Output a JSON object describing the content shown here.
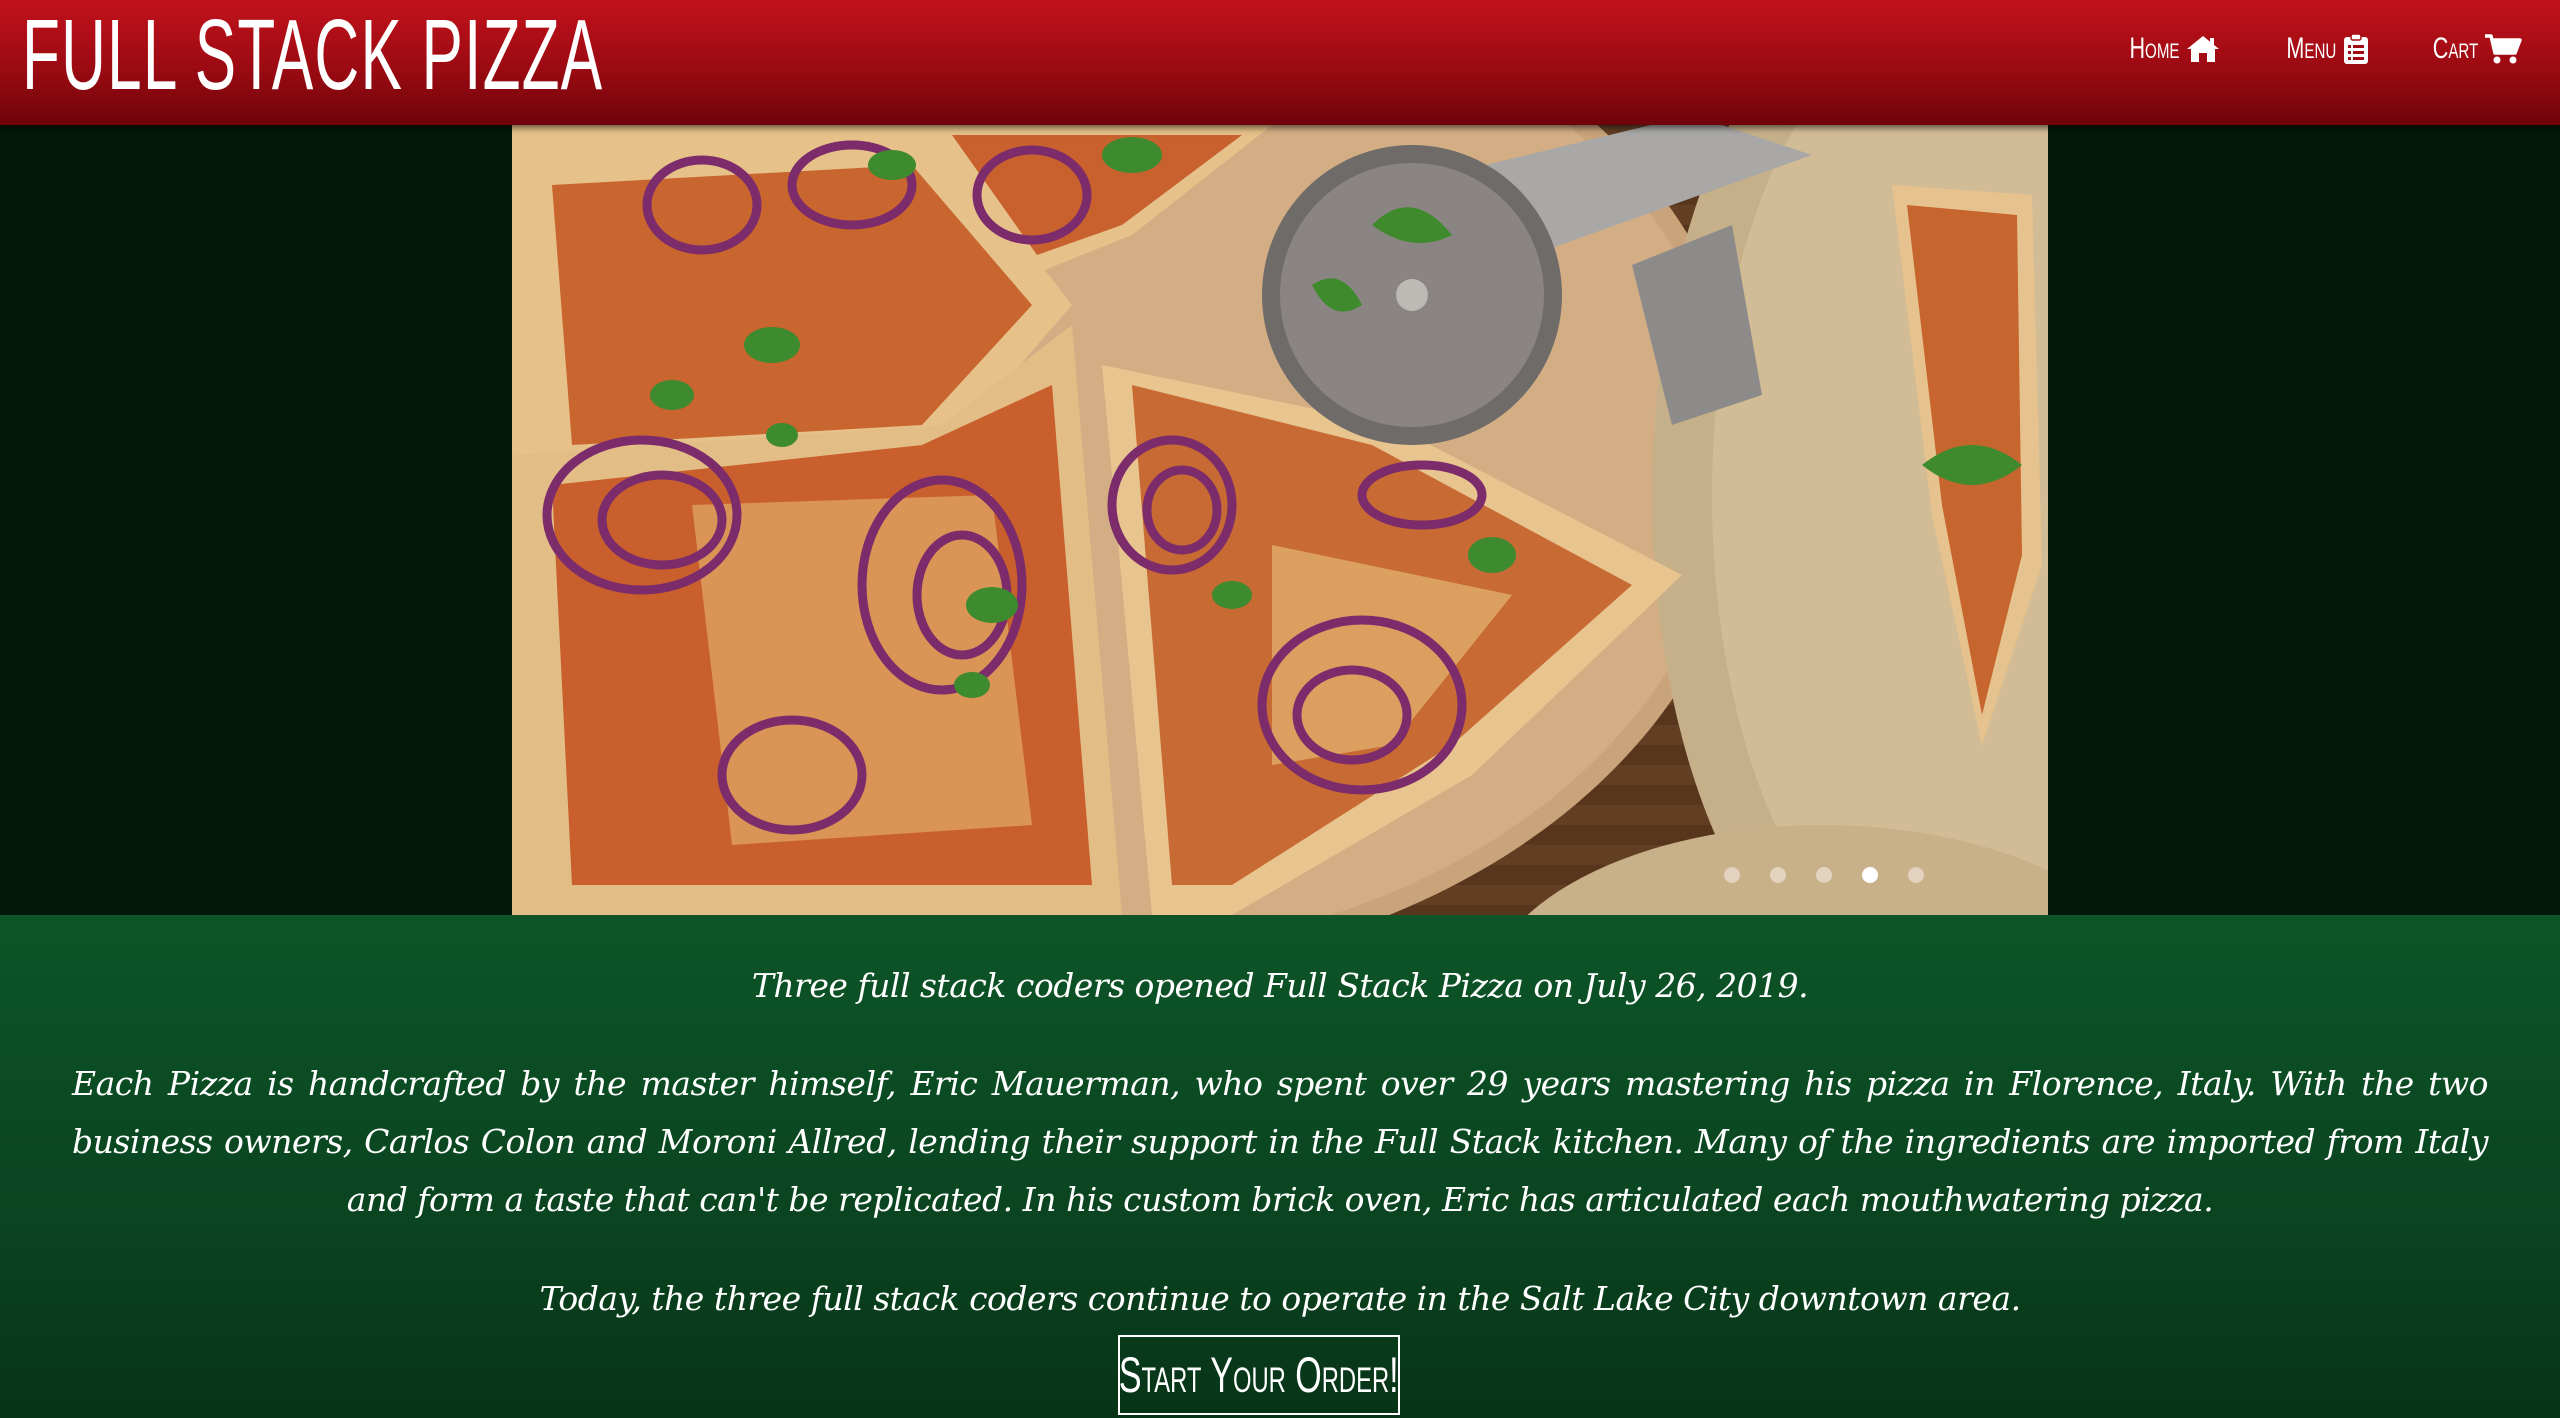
{
  "brand": {
    "title": "FULL STACK PIZZA"
  },
  "nav": {
    "items": [
      {
        "label": "Home",
        "icon": "home-icon"
      },
      {
        "label": "Menu",
        "icon": "clipboard-icon"
      },
      {
        "label": "Cart",
        "icon": "cart-icon"
      }
    ]
  },
  "carousel": {
    "slide_count": 5,
    "active_index": 3,
    "slide_subject": "pizza-photo"
  },
  "about": {
    "paragraph_1": "Three full stack coders opened Full Stack Pizza on July 26, 2019.",
    "paragraph_2": "Each Pizza is handcrafted by the master himself, Eric Mauerman, who spent over 29 years mastering his pizza in Florence, Italy. With the two business owners, Carlos Colon and Moroni Allred, lending their support in the Full Stack kitchen. Many of the ingredients are imported from Italy and form a taste that can't be replicated. In his custom brick oven, Eric has articulated each mouthwatering pizza.",
    "paragraph_3": "Today, the three full stack coders continue to operate in the Salt Lake City downtown area."
  },
  "cta": {
    "label": "Start Your Order!"
  },
  "colors": {
    "header_red": "#b30e17",
    "carousel_bg": "#021808",
    "about_green": "#0a4420",
    "text": "#ffffff"
  }
}
